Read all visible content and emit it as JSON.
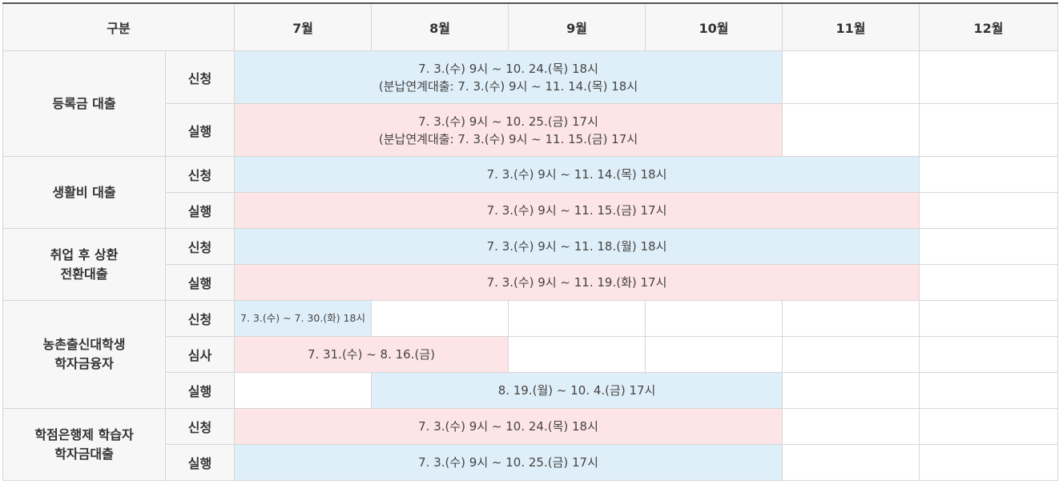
{
  "colors": {
    "apply": "#dfeff9",
    "execute": "#fde4e6",
    "header": "#f7f7f7",
    "border": "#d6d6d6"
  },
  "header": {
    "category": "구분",
    "months": [
      "7월",
      "8월",
      "9월",
      "10월",
      "11월",
      "12월"
    ]
  },
  "groups": [
    {
      "title": "등록금 대출",
      "rows": [
        {
          "stage": "신청",
          "lines": [
            "7. 3.(수) 9시 ~ 10. 24.(목) 18시",
            "(분납연계대출: 7. 3.(수) 9시 ~ 11. 14.(목) 18시"
          ]
        },
        {
          "stage": "실행",
          "lines": [
            "7. 3.(수) 9시 ~ 10. 25.(금) 17시",
            "(분납연계대출: 7. 3.(수) 9시 ~ 11. 15.(금) 17시"
          ]
        }
      ]
    },
    {
      "title": "생활비 대출",
      "rows": [
        {
          "stage": "신청",
          "lines": [
            "7. 3.(수) 9시 ~ 11. 14.(목) 18시"
          ]
        },
        {
          "stage": "실행",
          "lines": [
            "7. 3.(수) 9시 ~ 11. 15.(금) 17시"
          ]
        }
      ]
    },
    {
      "title_lines": [
        "취업 후 상환",
        "전환대출"
      ],
      "rows": [
        {
          "stage": "신청",
          "lines": [
            "7. 3.(수) 9시 ~ 11. 18.(월) 18시"
          ]
        },
        {
          "stage": "실행",
          "lines": [
            "7. 3.(수) 9시 ~ 11. 19.(화) 17시"
          ]
        }
      ]
    },
    {
      "title_lines": [
        "농촌출신대학생",
        "학자금융자"
      ],
      "rows": [
        {
          "stage": "신청",
          "lines": [
            "7. 3.(수) ~ 7. 30.(화) 18시"
          ]
        },
        {
          "stage": "심사",
          "lines": [
            "7. 31.(수) ~ 8. 16.(금)"
          ]
        },
        {
          "stage": "실행",
          "lines": [
            "8. 19.(월) ~ 10. 4.(금) 17시"
          ]
        }
      ]
    },
    {
      "title_lines": [
        "학점은행제 학습자",
        "학자금대출"
      ],
      "rows": [
        {
          "stage": "신청",
          "lines": [
            "7. 3.(수) 9시 ~ 10. 24.(목) 18시"
          ]
        },
        {
          "stage": "실행",
          "lines": [
            "7. 3.(수) 9시 ~ 10. 25.(금) 17시"
          ]
        }
      ]
    }
  ]
}
